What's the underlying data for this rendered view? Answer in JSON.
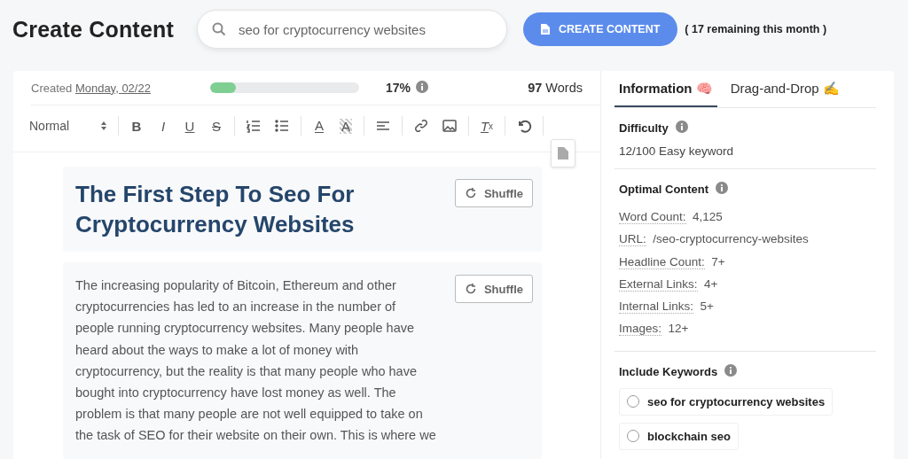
{
  "header": {
    "title": "Create Content",
    "search": {
      "value": "seo for cryptocurrency websites"
    },
    "create_button": "CREATE CONTENT",
    "remaining": "( 17 remaining this month )"
  },
  "editor": {
    "created_label": "Created",
    "created_date": "Monday, 02/22",
    "progress": {
      "level": 0.17
    },
    "percent": "17%",
    "words_count": "97",
    "words_label": "Words",
    "toolbar": [
      [
        {
          "kind": "select",
          "label": "Normal"
        }
      ],
      [
        {
          "kind": "bold",
          "label": "B"
        },
        {
          "kind": "italic",
          "label": "I"
        },
        {
          "kind": "underline",
          "label": "U"
        },
        {
          "kind": "strike",
          "label": "S"
        }
      ],
      [
        {
          "kind": "ordered-list"
        },
        {
          "kind": "bullet-list"
        }
      ],
      [
        {
          "kind": "color",
          "label": "A"
        },
        {
          "kind": "highlight",
          "label": "A"
        }
      ],
      [
        {
          "kind": "align"
        }
      ],
      [
        {
          "kind": "link"
        },
        {
          "kind": "image"
        }
      ],
      [
        {
          "kind": "clear",
          "label": "T",
          "sub": "x"
        }
      ],
      [
        {
          "kind": "undo"
        }
      ]
    ],
    "blocks": [
      {
        "kind": "heading",
        "lines": [
          "The First Step To Seo For",
          "Cryptocurrency Websites"
        ],
        "button": "Shuffle"
      },
      {
        "kind": "paragraph",
        "lines": [
          "The increasing popularity of Bitcoin, Ethereum and other",
          "cryptocurrencies has led to an increase in the number of",
          "people running cryptocurrency websites. Many people have",
          "heard about the ways to make a lot of money with",
          "cryptocurrency, but the reality is that many people who have",
          "bought into cryptocurrency have lost money as well. The",
          "problem is that many people are not well equipped to take on",
          "the task of SEO for their website on their own. This is where we"
        ],
        "button": "Shuffle"
      }
    ]
  },
  "sidebar": {
    "tabs": [
      {
        "label": "Information 🧠",
        "selected": true
      },
      {
        "label": "Drag-and-Drop ✍️",
        "selected": false
      }
    ],
    "difficulty": {
      "title": "Difficulty",
      "value": "12/100 Easy keyword"
    },
    "optimal": {
      "title": "Optimal Content",
      "rows": [
        {
          "label": "Word Count:",
          "value": "4,125"
        },
        {
          "label": "URL:",
          "value": "/seo-cryptocurrency-websites"
        },
        {
          "label": "Headline Count:",
          "value": "7+"
        },
        {
          "label": "External Links:",
          "value": "4+"
        },
        {
          "label": "Internal Links:",
          "value": "5+"
        },
        {
          "label": "Images:",
          "value": "12+"
        }
      ]
    },
    "keywords": {
      "title": "Include Keywords",
      "items": [
        {
          "label": "seo for cryptocurrency websites",
          "checked": false
        },
        {
          "label": "blockchain seo",
          "checked": false
        }
      ]
    }
  }
}
